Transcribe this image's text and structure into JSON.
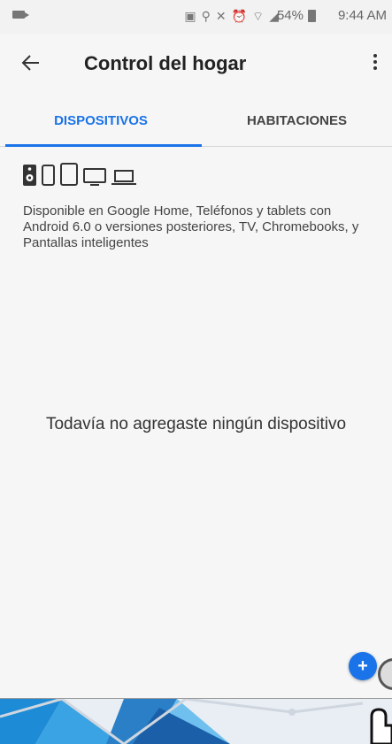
{
  "status_bar": {
    "battery": "54%",
    "time": "9:44 AM"
  },
  "app_bar": {
    "title": "Control del hogar"
  },
  "tabs": [
    {
      "label": "DISPOSITIVOS",
      "active": true
    },
    {
      "label": "HABITACIONES",
      "active": false
    }
  ],
  "device_types": [
    "speaker-icon",
    "phone-icon",
    "tablet-icon",
    "tv-icon",
    "laptop-icon"
  ],
  "availability_text": "Disponible en Google Home, Teléfonos y tablets con Android 6.0 o versiones posteriores, TV, Chromebooks, y Pantallas inteligentes",
  "empty_state": "Todavía no agregaste ningún dispositivo",
  "fab": {
    "symbol": "+"
  },
  "colors": {
    "accent": "#1a73e8",
    "background": "#f6f6f6"
  }
}
